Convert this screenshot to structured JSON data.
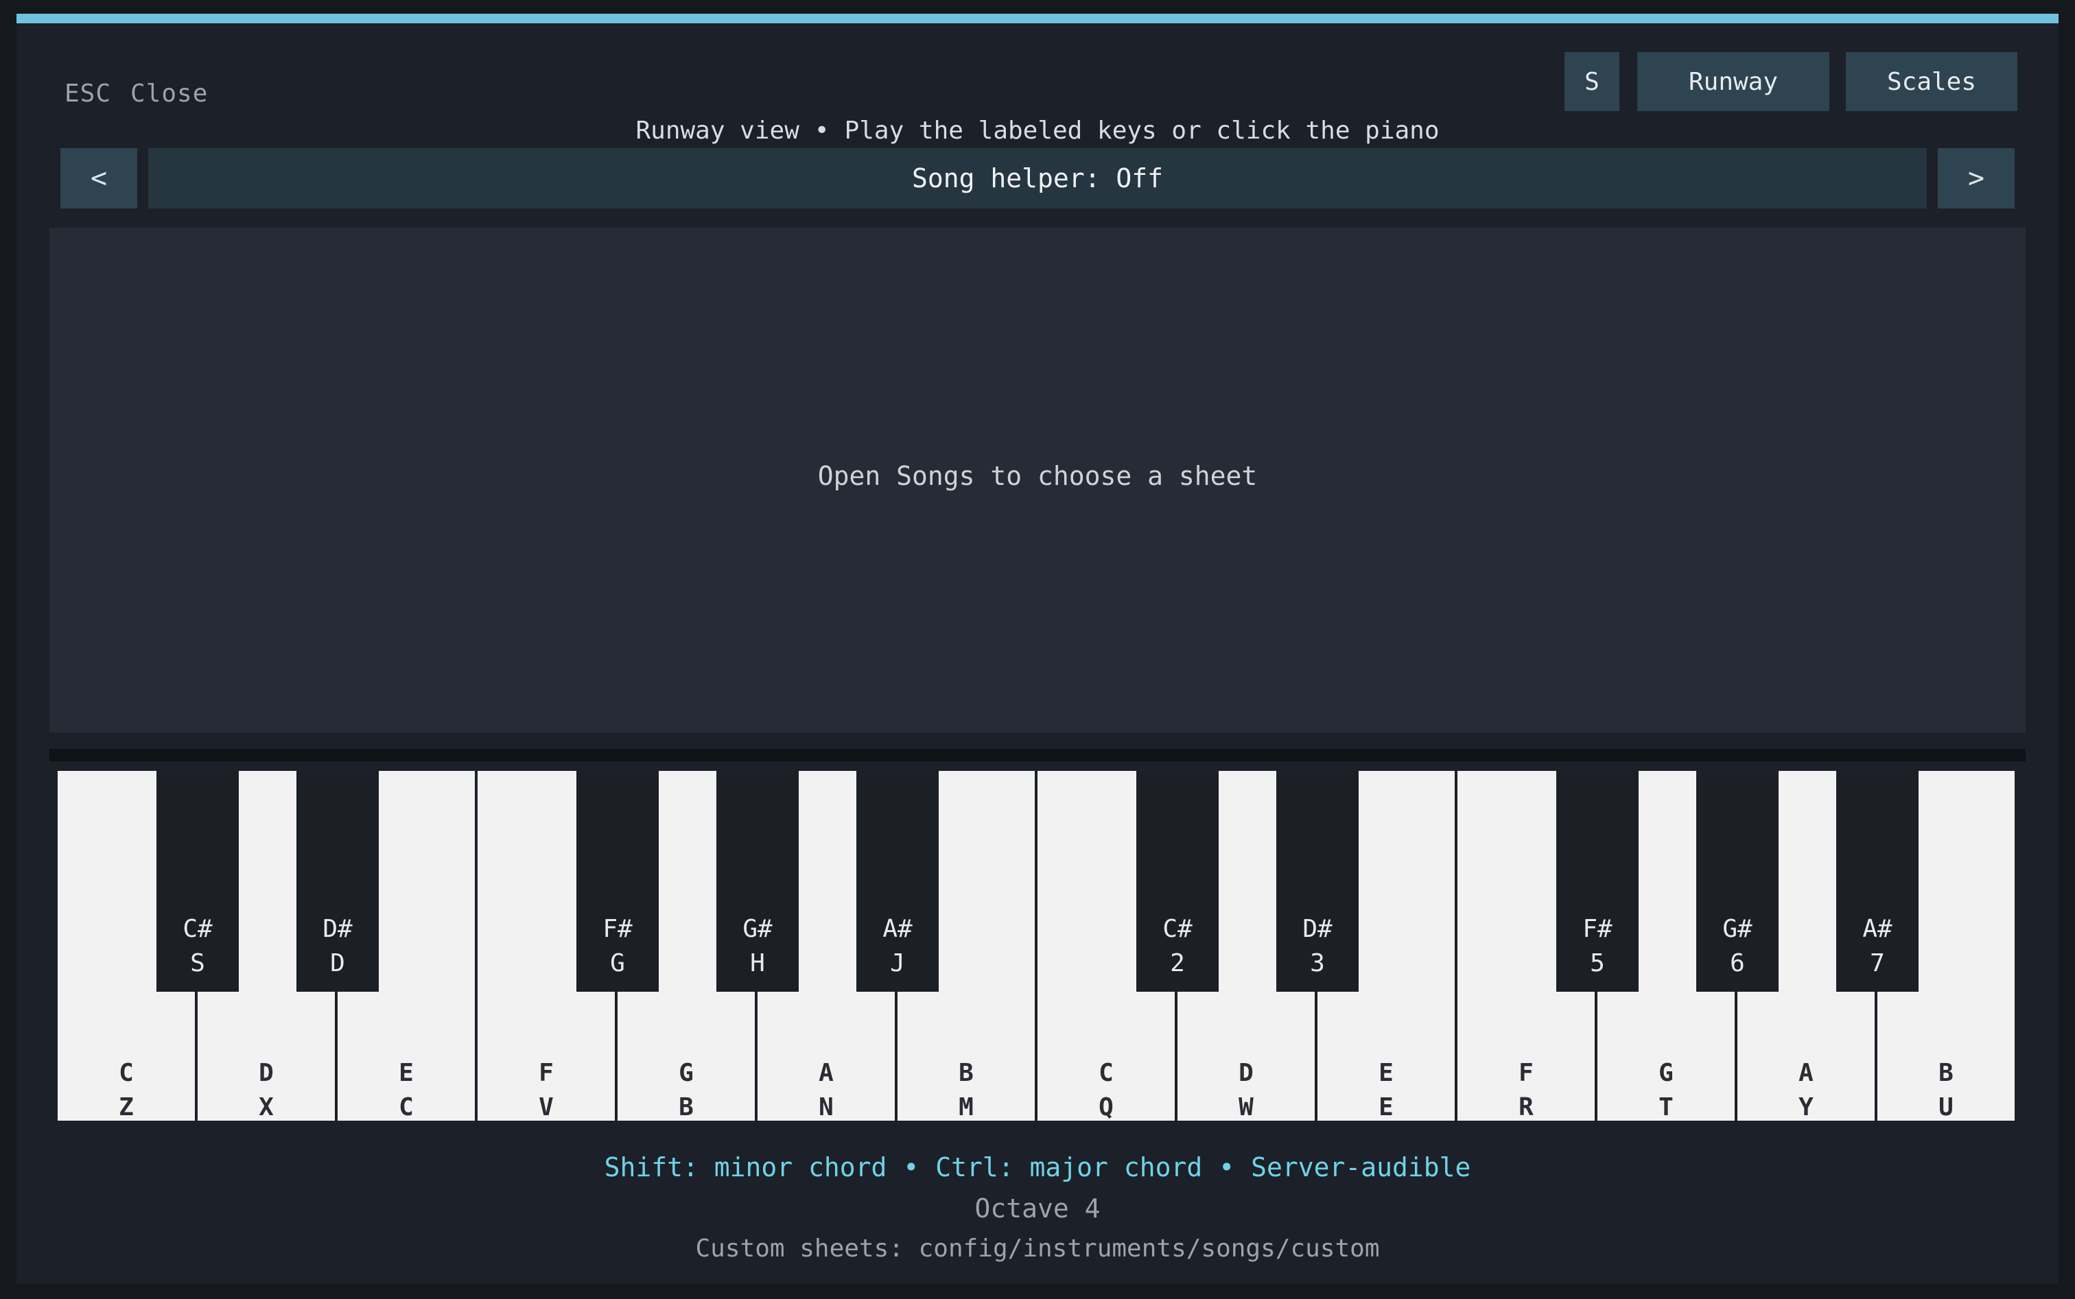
{
  "window": {
    "esc_key": "ESC",
    "close_label": "Close"
  },
  "toolbar": {
    "s_label": "S",
    "runway_label": "Runway",
    "scales_label": "Scales"
  },
  "subtitle": {
    "view": "Runway view",
    "separator": "•",
    "instruction": "Play the labeled keys or click the piano"
  },
  "helper": {
    "prev": "<",
    "label": "Song helper: Off",
    "next": ">"
  },
  "runway": {
    "message": "Open Songs to choose a sheet"
  },
  "piano": {
    "white_keys": [
      {
        "note": "C",
        "key": "Z"
      },
      {
        "note": "D",
        "key": "X"
      },
      {
        "note": "E",
        "key": "C"
      },
      {
        "note": "F",
        "key": "V"
      },
      {
        "note": "G",
        "key": "B"
      },
      {
        "note": "A",
        "key": "N"
      },
      {
        "note": "B",
        "key": "M"
      },
      {
        "note": "C",
        "key": "Q"
      },
      {
        "note": "D",
        "key": "W"
      },
      {
        "note": "E",
        "key": "E"
      },
      {
        "note": "F",
        "key": "R"
      },
      {
        "note": "G",
        "key": "T"
      },
      {
        "note": "A",
        "key": "Y"
      },
      {
        "note": "B",
        "key": "U"
      }
    ],
    "black_keys": [
      {
        "note": "C#",
        "key": "S"
      },
      {
        "note": "D#",
        "key": "D"
      },
      {
        "note": "F#",
        "key": "G"
      },
      {
        "note": "G#",
        "key": "H"
      },
      {
        "note": "A#",
        "key": "J"
      },
      {
        "note": "C#",
        "key": "2"
      },
      {
        "note": "D#",
        "key": "3"
      },
      {
        "note": "F#",
        "key": "5"
      },
      {
        "note": "G#",
        "key": "6"
      },
      {
        "note": "A#",
        "key": "7"
      }
    ]
  },
  "footer": {
    "minor": "Shift: minor chord",
    "major": "Ctrl: major chord",
    "audible": "Server-audible",
    "separator": "•",
    "octave": "Octave 4",
    "custom": "Custom sheets: config/instruments/songs/custom"
  },
  "colors": {
    "accent": "#6fc3df",
    "hint": "#6fd3e8",
    "button": "#2e4450",
    "panel": "#1c2028"
  }
}
